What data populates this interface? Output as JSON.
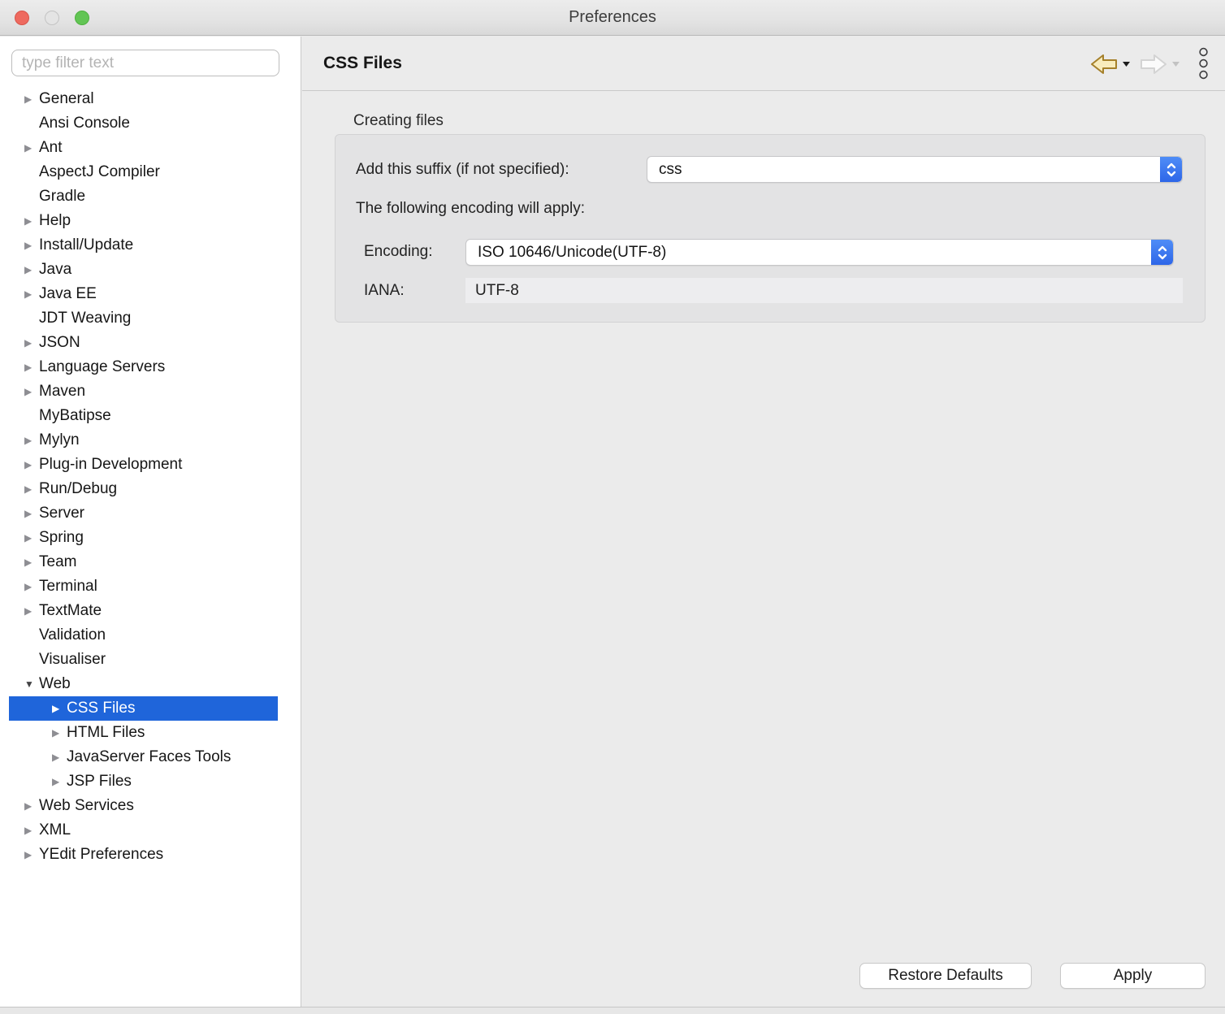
{
  "window": {
    "title": "Preferences"
  },
  "sidebar": {
    "filter_placeholder": "type filter text",
    "tree": [
      {
        "label": "General",
        "level": 0,
        "arrow": "collapsed"
      },
      {
        "label": "Ansi Console",
        "level": 0,
        "arrow": "none"
      },
      {
        "label": "Ant",
        "level": 0,
        "arrow": "collapsed"
      },
      {
        "label": "AspectJ Compiler",
        "level": 0,
        "arrow": "none"
      },
      {
        "label": "Gradle",
        "level": 0,
        "arrow": "none"
      },
      {
        "label": "Help",
        "level": 0,
        "arrow": "collapsed"
      },
      {
        "label": "Install/Update",
        "level": 0,
        "arrow": "collapsed"
      },
      {
        "label": "Java",
        "level": 0,
        "arrow": "collapsed"
      },
      {
        "label": "Java EE",
        "level": 0,
        "arrow": "collapsed"
      },
      {
        "label": "JDT Weaving",
        "level": 0,
        "arrow": "none"
      },
      {
        "label": "JSON",
        "level": 0,
        "arrow": "collapsed"
      },
      {
        "label": "Language Servers",
        "level": 0,
        "arrow": "collapsed"
      },
      {
        "label": "Maven",
        "level": 0,
        "arrow": "collapsed"
      },
      {
        "label": "MyBatipse",
        "level": 0,
        "arrow": "none"
      },
      {
        "label": "Mylyn",
        "level": 0,
        "arrow": "collapsed"
      },
      {
        "label": "Plug-in Development",
        "level": 0,
        "arrow": "collapsed"
      },
      {
        "label": "Run/Debug",
        "level": 0,
        "arrow": "collapsed"
      },
      {
        "label": "Server",
        "level": 0,
        "arrow": "collapsed"
      },
      {
        "label": "Spring",
        "level": 0,
        "arrow": "collapsed"
      },
      {
        "label": "Team",
        "level": 0,
        "arrow": "collapsed"
      },
      {
        "label": "Terminal",
        "level": 0,
        "arrow": "collapsed"
      },
      {
        "label": "TextMate",
        "level": 0,
        "arrow": "collapsed"
      },
      {
        "label": "Validation",
        "level": 0,
        "arrow": "none"
      },
      {
        "label": "Visualiser",
        "level": 0,
        "arrow": "none"
      },
      {
        "label": "Web",
        "level": 0,
        "arrow": "expanded"
      },
      {
        "label": "CSS Files",
        "level": 1,
        "arrow": "collapsed",
        "selected": true
      },
      {
        "label": "HTML Files",
        "level": 1,
        "arrow": "collapsed"
      },
      {
        "label": "JavaServer Faces Tools",
        "level": 1,
        "arrow": "collapsed"
      },
      {
        "label": "JSP Files",
        "level": 1,
        "arrow": "collapsed"
      },
      {
        "label": "Web Services",
        "level": 0,
        "arrow": "collapsed"
      },
      {
        "label": "XML",
        "level": 0,
        "arrow": "collapsed"
      },
      {
        "label": "YEdit Preferences",
        "level": 0,
        "arrow": "collapsed"
      }
    ]
  },
  "header": {
    "title": "CSS Files"
  },
  "content": {
    "group_title": "Creating files",
    "suffix_label": "Add this suffix (if not specified):",
    "suffix_value": "css",
    "encoding_intro": "The following encoding will apply:",
    "encoding_label": "Encoding:",
    "encoding_value": "ISO 10646/Unicode(UTF-8)",
    "iana_label": "IANA:",
    "iana_value": "UTF-8"
  },
  "footer": {
    "restore_defaults_label": "Restore Defaults",
    "apply_label": "Apply"
  },
  "colors": {
    "selection_blue": "#1f65da",
    "combo_accent_top": "#4f8df7",
    "combo_accent_bottom": "#2d66e8",
    "back_arrow_fill": "#f8ecbd",
    "back_arrow_stroke": "#a5802a"
  }
}
